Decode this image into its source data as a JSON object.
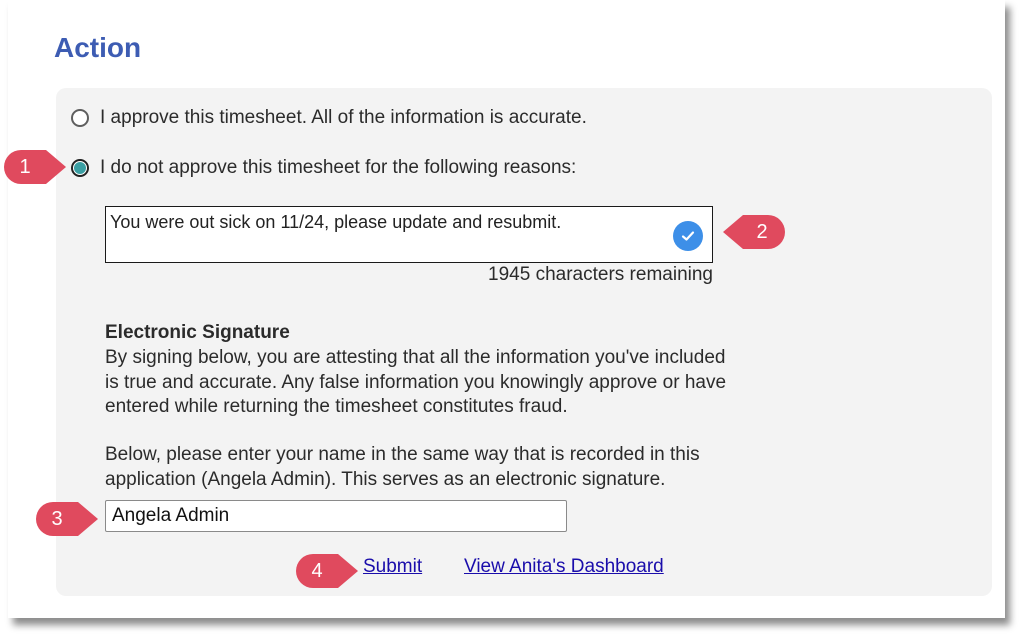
{
  "title": "Action",
  "options": {
    "approve_label": "I approve this timesheet. All of the information is accurate.",
    "reject_label": "I do not approve this timesheet for the following reasons:",
    "selected": "reject"
  },
  "reason": {
    "value": "You were out sick on 11/24, please update and resubmit.",
    "remaining_text": "1945 characters remaining"
  },
  "signature": {
    "heading": "Electronic Signature",
    "attest_lines": [
      "By signing below, you are attesting that all the information you've included",
      "is true and accurate. Any false information you knowingly approve or have",
      "entered while returning the timesheet constitutes fraud."
    ],
    "instruction_lines": [
      "Below, please enter your name in the same way that is recorded in this",
      "application (Angela Admin). This serves as an electronic signature."
    ],
    "name_value": "Angela Admin"
  },
  "actions": {
    "submit_label": "Submit",
    "dashboard_label": "View Anita's Dashboard"
  },
  "callouts": [
    "1",
    "2",
    "3",
    "4"
  ],
  "colors": {
    "title": "#3d5cb3",
    "callout": "#e04a5e",
    "radio_selected": "#3a9fa3",
    "check_badge": "#3d8fe8",
    "link": "#1a0dab"
  }
}
